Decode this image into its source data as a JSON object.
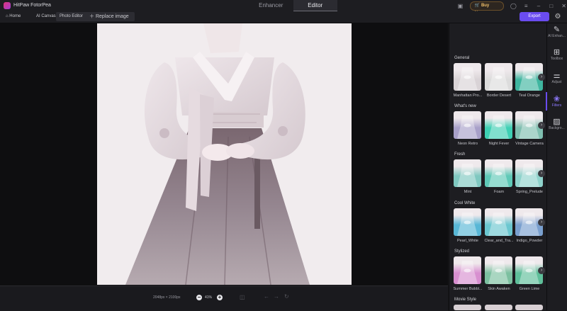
{
  "app": {
    "title": "HitPaw FotorPea"
  },
  "modes": [
    {
      "label": "Enhancer",
      "active": false
    },
    {
      "label": "Editor",
      "active": true
    }
  ],
  "titlebar": {
    "buy_now": "Buy Now"
  },
  "nav": {
    "home": "Home",
    "ai_canvas": "AI Canvas",
    "photo_editor": "Photo Editor",
    "replace_image": "Replace image",
    "export": "Export"
  },
  "bottom": {
    "dimensions": "2048px × 2100px",
    "zoom": "41%"
  },
  "filters": {
    "sections": [
      {
        "title": "General",
        "items": [
          "Manhattan Pro...",
          "Border Desert",
          "Teal Orange"
        ]
      },
      {
        "title": "What's new",
        "items": [
          "Neon Retro",
          "Night Fever",
          "Vintage Camera"
        ]
      },
      {
        "title": "Fresh",
        "items": [
          "Mint",
          "Foam",
          "Spring_Prelude"
        ]
      },
      {
        "title": "Cool White",
        "items": [
          "Pearl_White",
          "Clear_and_Tra...",
          "Indigo_Powder"
        ]
      },
      {
        "title": "Stylized",
        "items": [
          "Summer Bubbl...",
          "Skin Awaken",
          "Green Lime"
        ]
      },
      {
        "title": "Movie Style",
        "items": []
      }
    ],
    "thumb_colors": [
      [
        "#d9d3d6",
        "#dcdcdc",
        "#3fb6a0"
      ],
      [
        "#a8a0c9",
        "#3ed0b4",
        "#7fbfb0"
      ],
      [
        "#7fc8c0",
        "#5fc9b7",
        "#8fd3cc"
      ],
      [
        "#58b7d6",
        "#6bc7d0",
        "#7aa0cf"
      ],
      [
        "#d88fd0",
        "#7cc0a0",
        "#5fbf9a"
      ]
    ]
  },
  "tools": [
    {
      "label": "AI Enhan...",
      "icon": "sparkle-edit-icon"
    },
    {
      "label": "Toolbox",
      "icon": "grid-icon"
    },
    {
      "label": "Adjust",
      "icon": "sliders-icon"
    },
    {
      "label": "Filters",
      "icon": "filters-icon",
      "active": true
    },
    {
      "label": "Backgro...",
      "icon": "background-icon"
    }
  ]
}
